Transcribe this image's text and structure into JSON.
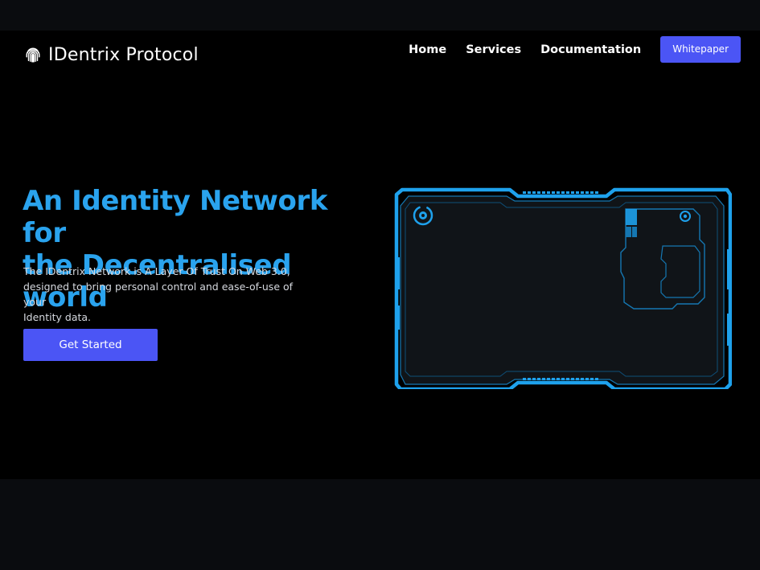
{
  "header": {
    "brand_icon": "fingerprint-icon",
    "brand_name": "IDentrix Protocol",
    "nav": [
      "Home",
      "Services",
      "Documentation"
    ],
    "cta_label": "Whitepaper"
  },
  "hero": {
    "title_line1": "An Identity Network for",
    "title_line2": "the Decentralised world",
    "description_line1": "The IDentrix Network is A Layer Of Trust On Web 3.0,",
    "description_line2": "designed to bring personal control and ease-of-use of your",
    "description_line3": "Identity data.",
    "button_label": "Get Started",
    "illustration": "hud-frame-illustration"
  },
  "colors": {
    "background": "#000000",
    "accent_blue": "#2aa3ee",
    "button": "#4b55f5",
    "text_light": "#d6d9df"
  }
}
